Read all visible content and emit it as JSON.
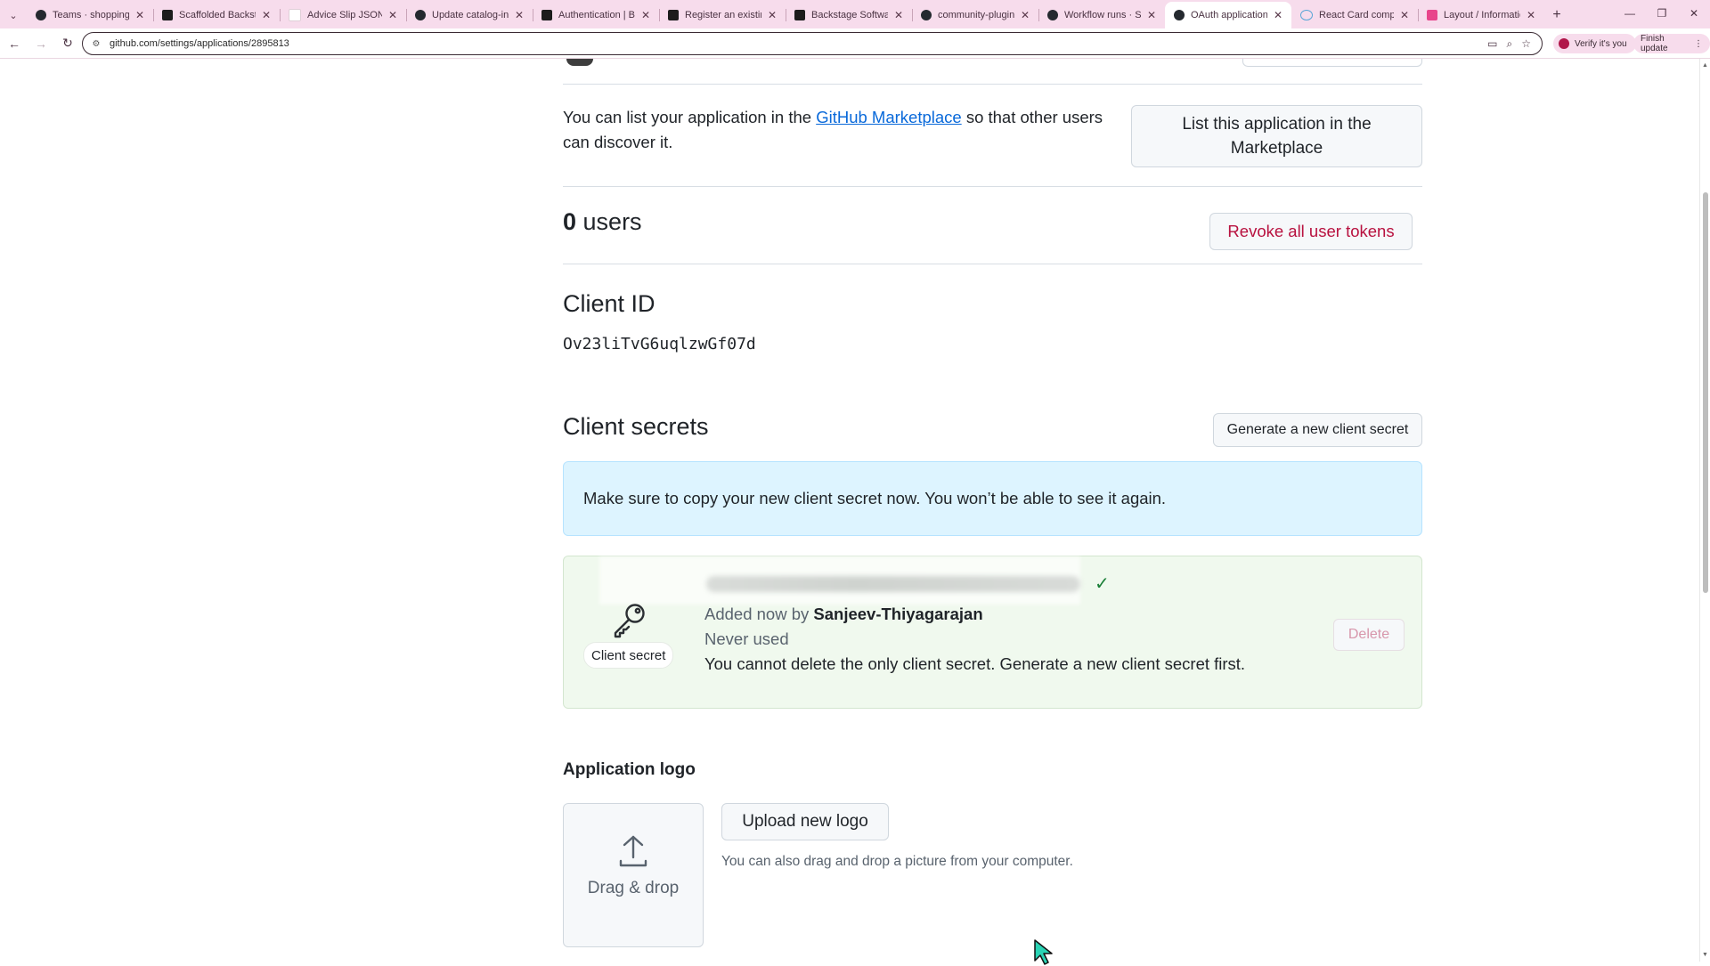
{
  "browser": {
    "tabs": [
      {
        "title": "Teams · shopping-hub",
        "favicon": "github"
      },
      {
        "title": "Scaffolded Backstage",
        "favicon": "backstage"
      },
      {
        "title": "Advice Slip JSON API",
        "favicon": "blank"
      },
      {
        "title": "Update catalog-info.y",
        "favicon": "github"
      },
      {
        "title": "Authentication | Backs",
        "favicon": "backstage"
      },
      {
        "title": "Register an existing co",
        "favicon": "backstage"
      },
      {
        "title": "Backstage Software Ca",
        "favicon": "backstage"
      },
      {
        "title": "community-plugins/w",
        "favicon": "github"
      },
      {
        "title": "Workflow runs · Sanjee",
        "favicon": "github"
      },
      {
        "title": "OAuth application setti",
        "favicon": "github",
        "active": true
      },
      {
        "title": "React Card componen",
        "favicon": "react"
      },
      {
        "title": "Layout / Information C",
        "favicon": "pink"
      }
    ],
    "url": "github.com/settings/applications/2895813",
    "verify_label": "Verify it's you",
    "finish_update_label": "Finish update"
  },
  "marketplace": {
    "text_before": "You can list your application in the ",
    "link": "GitHub Marketplace",
    "text_after": " so that other users can discover it.",
    "button": "List this application in the Marketplace"
  },
  "users": {
    "count": "0",
    "label": " users",
    "revoke_button": "Revoke all user tokens"
  },
  "client_id": {
    "heading": "Client ID",
    "value": "Ov23liTvG6uqlzwGf07d"
  },
  "client_secrets": {
    "heading": "Client secrets",
    "generate_button": "Generate a new client secret",
    "flash": "Make sure to copy your new client secret now. You won’t be able to see it again.",
    "secret": {
      "badge": "Client secret",
      "added_prefix": "Added now by ",
      "added_by": "Sanjeev-Thiyagarajan",
      "usage": "Never used",
      "note": "You cannot delete the only client secret. Generate a new client secret first.",
      "delete_button": "Delete"
    }
  },
  "logo": {
    "heading": "Application logo",
    "dropzone_label": "Drag & drop",
    "upload_button": "Upload new logo",
    "hint": "You can also drag and drop a picture from your computer."
  },
  "colors": {
    "accent_link": "#0969da",
    "danger": "#b8113f",
    "success": "#1a7f37",
    "flash_bg": "#ddf4ff",
    "secret_bg": "#f0f9ee"
  }
}
